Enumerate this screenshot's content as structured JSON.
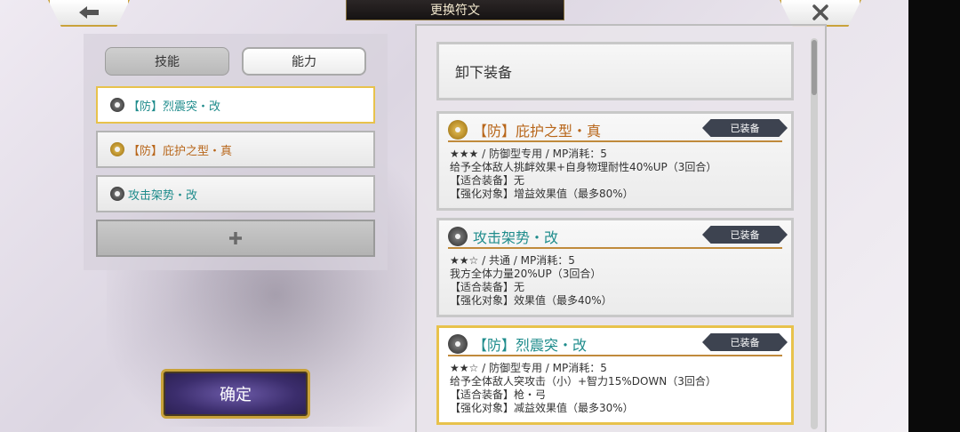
{
  "header": {
    "title": "更换符文",
    "back_icon": "arrow-left-icon",
    "close_icon": "close-icon"
  },
  "tabs": [
    {
      "label": "技能"
    },
    {
      "label": "能力"
    }
  ],
  "slots": [
    {
      "label": "【防】烈震突・改",
      "icon": "rune-gray-icon"
    },
    {
      "label": "【防】庇护之型・真",
      "icon": "rune-gold-icon"
    },
    {
      "label": "攻击架势・改",
      "icon": "rune-gray-icon"
    }
  ],
  "add_slot_icon": "plus-icon",
  "confirm_label": "确定",
  "unequip_label": "卸下装备",
  "cards": [
    {
      "title": "【防】庇护之型・真",
      "badge": "已装备",
      "meta": "★★★ / 防御型专用 / MP消耗：5",
      "desc": "给予全体敌人挑衅效果+自身物理耐性40%UP（3回合）",
      "equip": "【适合装备】无",
      "target": "【强化对象】增益效果值（最多80%）"
    },
    {
      "title": "攻击架势・改",
      "badge": "已装备",
      "meta": "★★☆ / 共通 / MP消耗：5",
      "desc": "我方全体力量20%UP（3回合）",
      "equip": "【适合装备】无",
      "target": "【强化对象】效果值（最多40%）"
    },
    {
      "title": "【防】烈震突・改",
      "badge": "已装备",
      "meta": "★★☆ / 防御型专用 / MP消耗：5",
      "desc": "给予全体敌人突攻击（小）+智力15%DOWN（3回合）",
      "equip": "【适合装备】枪・弓",
      "target": "【强化对象】减益效果值（最多30%）"
    }
  ],
  "colors": {
    "accent_gold": "#e8c24c",
    "teal_text": "#1f8c8c",
    "orange_text": "#b8661a",
    "confirm_purple": "#3b2d6c"
  }
}
